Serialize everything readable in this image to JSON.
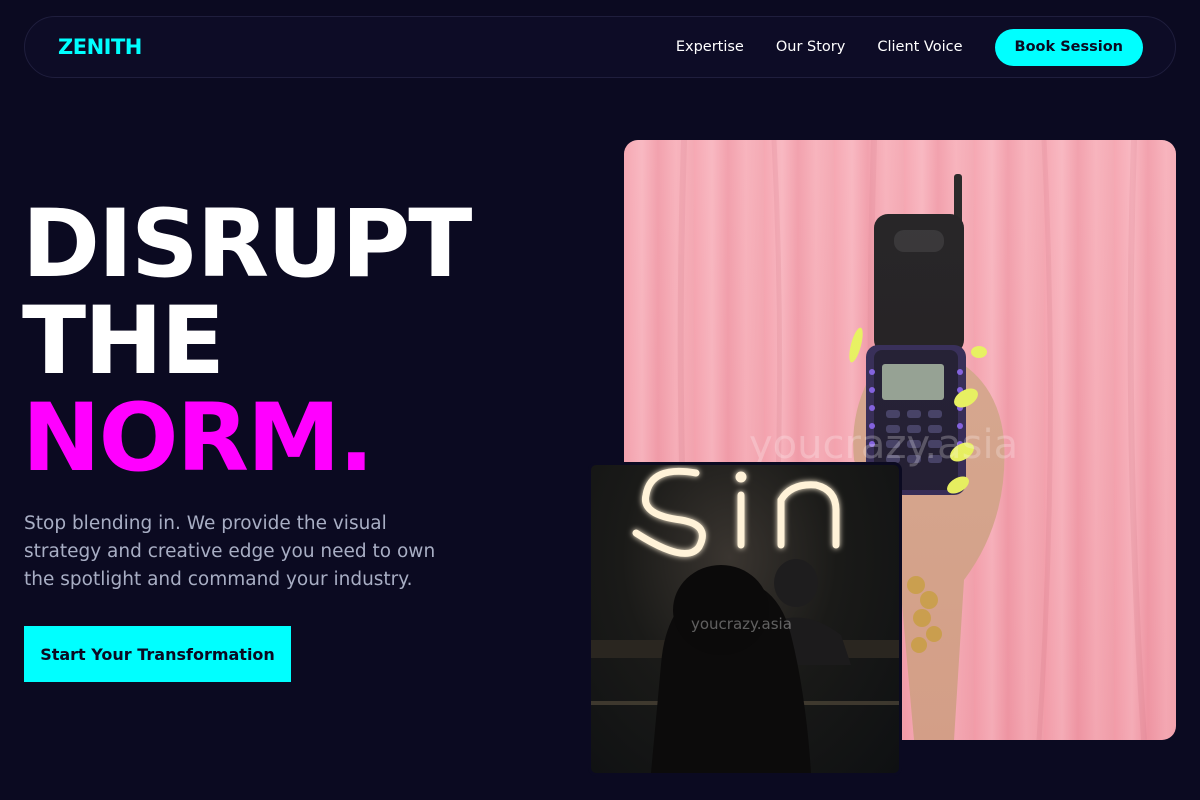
{
  "nav": {
    "logo": "ZENITH",
    "links": [
      "Expertise",
      "Our Story",
      "Client Voice"
    ],
    "cta": "Book Session"
  },
  "hero": {
    "line1": "DISRUPT",
    "line2": "THE",
    "line3": "NORM",
    "line3_dot": ".",
    "subtext": "Stop blending in. We provide the visual strategy and creative edge you need to own the spotlight and command your industry.",
    "cta": "Start Your Transformation"
  },
  "images": {
    "main_watermark": "youcrazy.asia",
    "small_watermark": "youcrazy.asia",
    "small_neon_text": "Sin"
  },
  "colors": {
    "background": "#0b0a21",
    "accent_cyan": "#00ffff",
    "accent_magenta": "#ff00ff"
  }
}
